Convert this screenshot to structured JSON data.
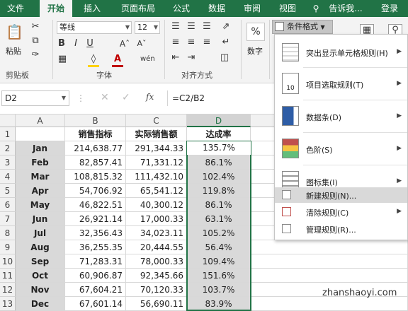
{
  "tabs": [
    "文件",
    "开始",
    "插入",
    "页面布局",
    "公式",
    "数据",
    "审阅",
    "视图",
    "告诉我...",
    "登录"
  ],
  "ribbon": {
    "paste": "粘贴",
    "clipboard": "剪贴板",
    "font": "字体",
    "font_name": "等线",
    "font_size": "12",
    "align": "对齐方式",
    "percent": "%",
    "number": "数字",
    "cond_format": "条件格式"
  },
  "formula": {
    "name_box": "D2",
    "fx": "fx",
    "formula": "=C2/B2"
  },
  "columns": [
    "A",
    "B",
    "C",
    "D"
  ],
  "header_row": [
    "",
    "销售指标",
    "实际销售额",
    "达成率"
  ],
  "rows": [
    [
      "Jan",
      "214,638.77",
      "291,344.33",
      "135.7%"
    ],
    [
      "Feb",
      "82,857.41",
      "71,331.12",
      "86.1%"
    ],
    [
      "Mar",
      "108,815.32",
      "111,432.10",
      "102.4%"
    ],
    [
      "Apr",
      "54,706.92",
      "65,541.12",
      "119.8%"
    ],
    [
      "May",
      "46,822.51",
      "40,300.12",
      "86.1%"
    ],
    [
      "Jun",
      "26,921.14",
      "17,000.33",
      "63.1%"
    ],
    [
      "Jul",
      "32,356.43",
      "34,023.11",
      "105.2%"
    ],
    [
      "Aug",
      "36,255.35",
      "20,444.55",
      "56.4%"
    ],
    [
      "Sep",
      "71,283.31",
      "78,000.33",
      "109.4%"
    ],
    [
      "Oct",
      "60,906.87",
      "92,345.66",
      "151.6%"
    ],
    [
      "Nov",
      "67,604.21",
      "70,120.33",
      "103.7%"
    ],
    [
      "Dec",
      "67,601.14",
      "56,690.11",
      "83.9%"
    ]
  ],
  "row_numbers": [
    "1",
    "2",
    "3",
    "4",
    "5",
    "6",
    "7",
    "8",
    "9",
    "10",
    "11",
    "12",
    "13"
  ],
  "menu": {
    "highlight": "突出显示单元格规则(H)",
    "topbottom": "项目选取规则(T)",
    "databar": "数据条(D)",
    "colorscale": "色阶(S)",
    "iconset": "图标集(I)",
    "newrule": "新建规则(N)...",
    "clear": "清除规则(C)",
    "manage": "管理规则(R)..."
  },
  "watermark": "zhanshaoyi.com",
  "colors": {
    "excel_green": "#217346",
    "gray_fill": "#d9d9d9"
  }
}
